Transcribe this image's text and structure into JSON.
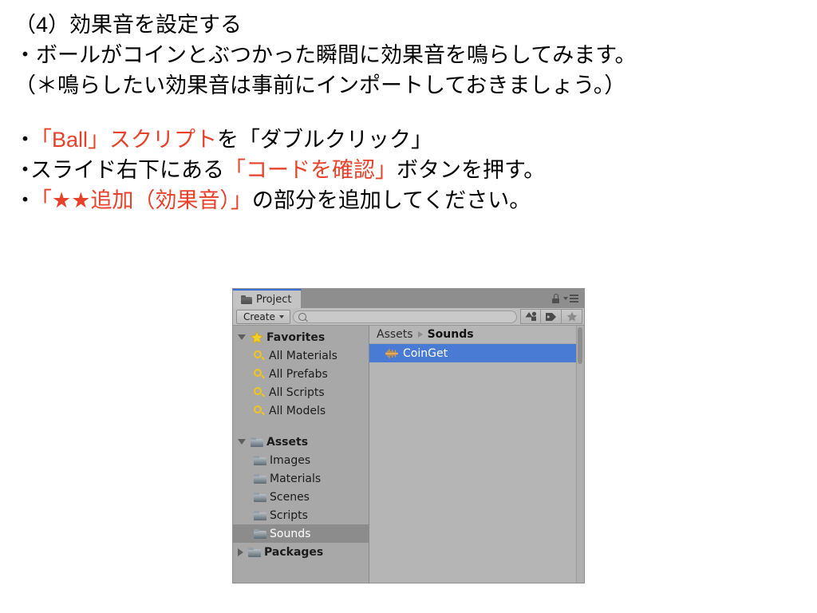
{
  "slide": {
    "heading": "（4）効果音を設定する",
    "lines": [
      {
        "text": "・ボールがコインとぶつかった瞬間に効果音を鳴らしてみます。",
        "color": "black"
      },
      {
        "text": "（＊鳴らしたい効果音は事前にインポートしておきましょう。）",
        "color": "black"
      }
    ],
    "bullets": [
      {
        "marker": "・",
        "segments": [
          {
            "text": "「Ball」スクリプト",
            "color": "red"
          },
          {
            "text": "を「ダブルクリック」",
            "color": "black"
          }
        ]
      },
      {
        "marker": "・",
        "segments": [
          {
            "text": "スライド右下にある",
            "color": "black"
          },
          {
            "text": "「コードを確認」",
            "color": "red"
          },
          {
            "text": "ボタンを押す。",
            "color": "black"
          }
        ]
      },
      {
        "marker": "・",
        "segments": [
          {
            "text": "「★★追加（効果音）」",
            "color": "red"
          },
          {
            "text": "の部分を追加してください。",
            "color": "black"
          }
        ]
      }
    ],
    "colors": {
      "accent_red": "#E8412A",
      "body_black": "#000000"
    }
  },
  "unity": {
    "tab": {
      "label": "Project",
      "icon": "folder-icon"
    },
    "window_controls": {
      "lock": "lock-icon",
      "menu": "hamburger-menu-icon"
    },
    "toolbar": {
      "create_label": "Create",
      "create_caret": "chevron-down-icon",
      "search_placeholder": "",
      "search_value": "",
      "search_icon": "search-icon",
      "filter_buttons": [
        {
          "name": "filter-by-type-icon",
          "label": ""
        },
        {
          "name": "filter-by-label-icon",
          "label": ""
        },
        {
          "name": "filter-by-favorite-icon",
          "label": ""
        }
      ]
    },
    "tree": {
      "favorites": {
        "label": "Favorites",
        "expanded": true,
        "icon": "star-icon",
        "children": [
          {
            "label": "All Materials",
            "icon": "search-icon"
          },
          {
            "label": "All Prefabs",
            "icon": "search-icon"
          },
          {
            "label": "All Scripts",
            "icon": "search-icon"
          },
          {
            "label": "All Models",
            "icon": "search-icon"
          }
        ]
      },
      "assets": {
        "label": "Assets",
        "expanded": true,
        "icon": "folder-icon",
        "children": [
          {
            "label": "Images",
            "icon": "folder-icon",
            "selected": false
          },
          {
            "label": "Materials",
            "icon": "folder-icon",
            "selected": false
          },
          {
            "label": "Scenes",
            "icon": "folder-icon",
            "selected": false
          },
          {
            "label": "Scripts",
            "icon": "folder-icon",
            "selected": false
          },
          {
            "label": "Sounds",
            "icon": "folder-icon",
            "selected": true
          }
        ]
      },
      "packages": {
        "label": "Packages",
        "expanded": false,
        "icon": "folder-icon"
      }
    },
    "content": {
      "breadcrumb": [
        {
          "label": "Assets",
          "current": false
        },
        {
          "label": "Sounds",
          "current": true
        }
      ],
      "items": [
        {
          "label": "CoinGet",
          "icon": "audio-waveform-icon",
          "selected": true
        }
      ]
    },
    "colors": {
      "selection_blue": "#4A7BD4",
      "tab_accent": "#3B6FD4",
      "panel_bg": "#A5A5A5",
      "content_bg": "#B5B5B5",
      "tree_selected": "#8C8C8C",
      "star_yellow": "#F2C41D",
      "waveform_orange": "#E89A25"
    }
  }
}
